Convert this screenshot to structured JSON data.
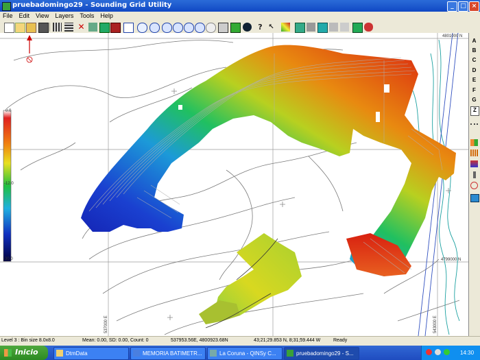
{
  "window": {
    "title": "pruebadomingo29 - Sounding Grid Utility",
    "min": "_",
    "max": "□",
    "close": "×"
  },
  "menu": [
    "File",
    "Edit",
    "View",
    "Layers",
    "Tools",
    "Help"
  ],
  "toolbar": {
    "icons": [
      "new-icon",
      "open-icon",
      "open-folder-icon",
      "save-icon",
      "print-icon",
      "grid-icon",
      "grid2-icon",
      "delete-icon",
      "pick-icon",
      "color-icon",
      "export-icon",
      "page-icon",
      "zoom-box-icon",
      "zoom-in-icon",
      "zoom-out-icon",
      "zoom-all-icon",
      "zoom-prev-icon",
      "zoom-next-icon",
      "zoom-window-icon",
      "layers-icon",
      "flag-icon",
      "info-icon",
      "question-icon",
      "help-pointer-icon",
      "contour-icon",
      "palette-icon",
      "shade-icon",
      "grid-overlay-icon",
      "wave-icon",
      "draw-icon",
      "map-icon",
      "run-icon"
    ],
    "layer_select": "s3"
  },
  "map": {
    "north_coord": "4801000 N",
    "south_coord": "4799000 N",
    "west_coord": "537000 E",
    "east_coord": "543000 E",
    "scale_labels": {
      "top": "0.0",
      "mid": "-12.0",
      "bottom": "-30.0"
    },
    "colors": {
      "deep": "#1010a0",
      "mid": "#20c060",
      "shallow": "#e02010",
      "yellow": "#d8d820"
    }
  },
  "side_letters": [
    "A",
    "B",
    "C",
    "D",
    "E",
    "F",
    "G",
    "Z"
  ],
  "side_icons": [
    "more-icon",
    "grid-color-icon",
    "bars-icon",
    "wave-tool-icon",
    "pen-icon",
    "rotate-icon",
    "phone-icon"
  ],
  "status": {
    "level": "Level 3 : Bin size 8.0x8.0",
    "stats": "Mean: 0.00, SD: 0.00, Count: 0",
    "coords_en": "537953.56E, 4800923.68N",
    "coords_geo": "43;21;29.853 N,    8;31;59.444 W",
    "ready": "Ready"
  },
  "taskbar": {
    "start": "Inicio",
    "tasks": [
      "DtmData",
      "MEMORIA BATIMETR...",
      "La Coruna - QINSy C...",
      "pruebadomingo29 - S..."
    ],
    "active_task": 3,
    "clock": "14:30"
  }
}
